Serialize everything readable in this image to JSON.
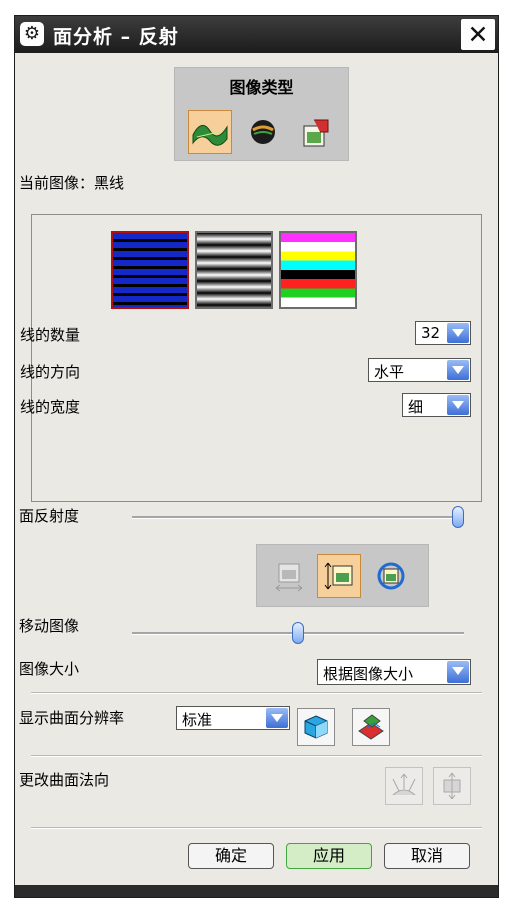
{
  "window": {
    "title": "面分析 – 反射",
    "close_label": "✕"
  },
  "image_type": {
    "title": "图像类型",
    "buttons": [
      {
        "name": "reflection-surface-icon",
        "active": true
      },
      {
        "name": "sphere-icon",
        "active": false
      },
      {
        "name": "user-image-icon",
        "active": false
      }
    ]
  },
  "current_image": {
    "label": "当前图像：",
    "value": "黑线"
  },
  "swatches": [
    "blue-lines",
    "black-white-gradient-lines",
    "color-lines"
  ],
  "line_count": {
    "label": "线的数量",
    "value": "32"
  },
  "line_direction": {
    "label": "线的方向",
    "value": "水平"
  },
  "line_width": {
    "label": "线的宽度",
    "value": "细"
  },
  "face_reflectivity": {
    "label": "面反射度",
    "level": 1.0
  },
  "move_image": {
    "label": "移动图像",
    "level": 0.5
  },
  "image_size": {
    "label": "图像大小",
    "value": "根据图像大小"
  },
  "display_resolution": {
    "label": "显示曲面分辨率",
    "value": "标准"
  },
  "change_normal": {
    "label": "更改曲面法向"
  },
  "buttons": {
    "ok": "确定",
    "apply": "应用",
    "cancel": "取消"
  }
}
